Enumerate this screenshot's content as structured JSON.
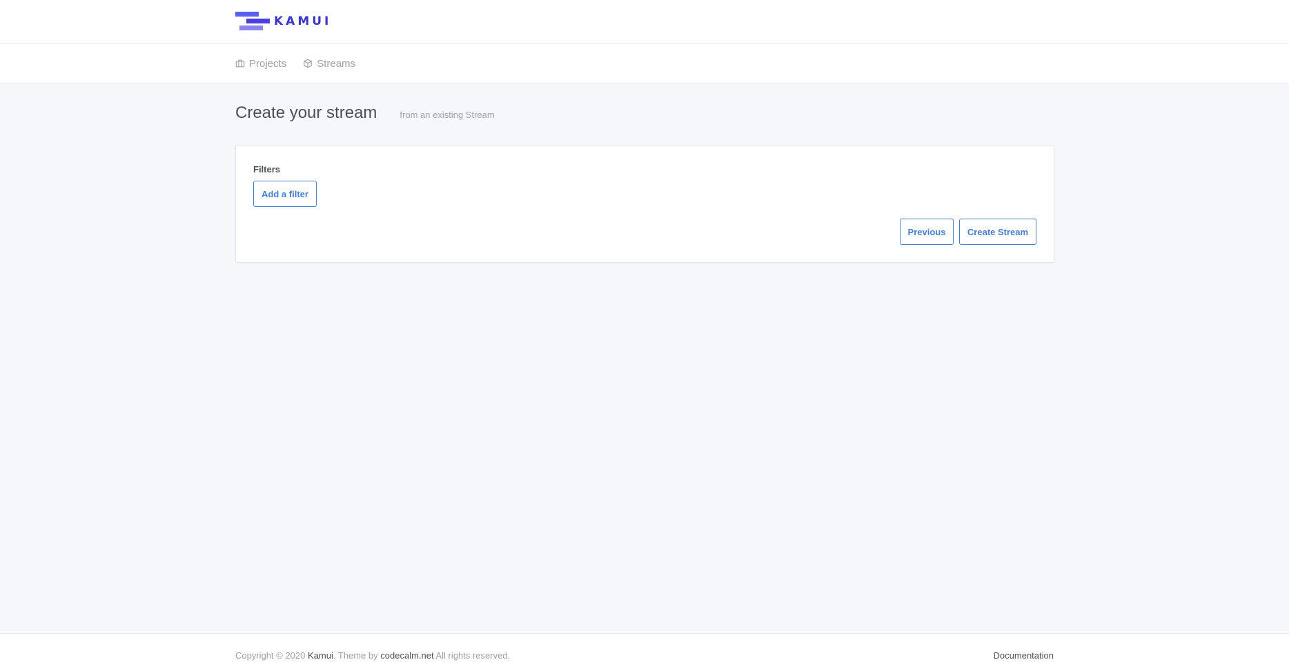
{
  "brand": {
    "name": "KAMUI",
    "colors": {
      "primary": "#3a36c9",
      "bar_top": "#5b5ff0",
      "bar_mid": "#4b3ee0",
      "bar_bottom": "#8f84ee"
    }
  },
  "nav": {
    "items": [
      {
        "label": "Projects",
        "icon": "briefcase-icon"
      },
      {
        "label": "Streams",
        "icon": "box-icon"
      }
    ]
  },
  "page": {
    "title": "Create your stream",
    "subtitle": "from an existing Stream"
  },
  "form": {
    "filters_label": "Filters",
    "add_filter_label": "Add a filter",
    "previous_label": "Previous",
    "create_label": "Create Stream",
    "accent_color": "#467fcf"
  },
  "footer": {
    "copyright_prefix": "Copyright © 2020",
    "brand_link": "Kamui",
    "theme_text": ". Theme by",
    "theme_link": "codecalm.net",
    "rights": "All rights reserved.",
    "documentation_link": "Documentation"
  }
}
